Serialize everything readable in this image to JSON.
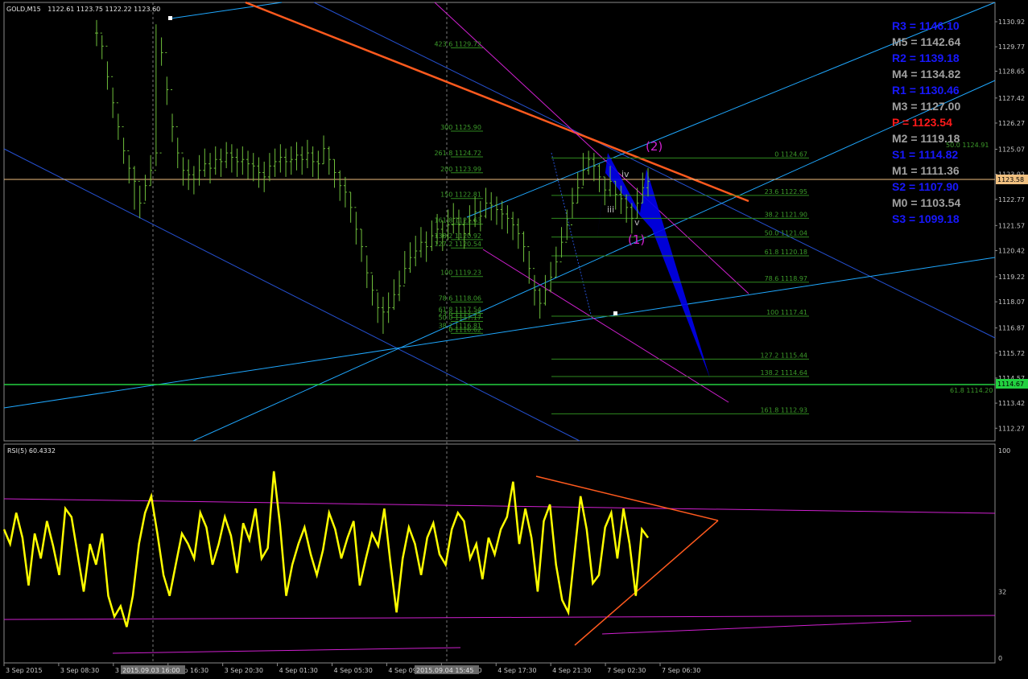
{
  "header": {
    "symbol": "GOLD,M15",
    "ohlc": "1122.61 1123.75 1122.22 1123.60",
    "rsi_title": "RSI(5) 60.4332"
  },
  "colors": {
    "background": "#000000",
    "grid": "#5a5a5a",
    "candle": "#6fbf3c",
    "rsi_line": "#ffff00",
    "trend_orange": "#ff5a1e",
    "channel_light": "#1fa8ff",
    "channel_dark": "#2550d0",
    "magenta": "#d020d0",
    "fib": "#2f8a1f",
    "price_line": "#f0c080",
    "pattern": "#0000f0"
  },
  "chart_data": [
    {
      "type": "line",
      "name": "price",
      "ylim": [
        1111.8,
        1131.4
      ],
      "yticks": [
        "1130.92",
        "1129.77",
        "1128.65",
        "1127.42",
        "1126.27",
        "1125.07",
        "1123.92",
        "1122.77",
        "1121.57",
        "1120.42",
        "1119.22",
        "1118.07",
        "1116.87",
        "1115.72",
        "1114.57",
        "1113.42",
        "1112.27"
      ],
      "xticks": [
        "3 Sep 2015",
        "3 Sep 08:30",
        "3 Sep 12:30",
        "3 Sep 16:30",
        "3 Sep 20:30",
        "4 Sep 01:30",
        "4 Sep 05:30",
        "4 Sep 09:30",
        "4 Sep 13:30",
        "4 Sep 17:30",
        "4 Sep 21:30",
        "7 Sep 02:30",
        "7 Sep 06:30"
      ],
      "xtick_overlays": [
        "2015.09.03 16:00",
        "2015.09.04 15:45"
      ],
      "x_count": 200,
      "close": [
        1130.4,
        1129.8,
        1128.4,
        1127.2,
        1126.1,
        1125.0,
        1124.2,
        1123.6,
        1122.6,
        1123.4,
        1124.1,
        1124.9,
        1129.5,
        1127.8,
        1126.1,
        1124.9,
        1124.1,
        1123.9,
        1123.7,
        1124.1,
        1124.4,
        1124.2,
        1124.6,
        1124.5,
        1124.9,
        1124.7,
        1124.5,
        1124.6,
        1124.4,
        1124.3,
        1124.0,
        1123.8,
        1124.3,
        1124.5,
        1124.7,
        1124.5,
        1124.6,
        1124.8,
        1124.6,
        1124.9,
        1124.5,
        1124.4,
        1125.1,
        1124.6,
        1124.0,
        1123.4,
        1123.1,
        1122.4,
        1121.4,
        1120.6,
        1119.4,
        1118.6,
        1117.8,
        1117.6,
        1117.8,
        1118.4,
        1118.8,
        1119.6,
        1120.1,
        1120.4,
        1120.8,
        1120.6,
        1121.1,
        1121.4,
        1121.1,
        1121.6,
        1121.9,
        1121.6,
        1121.2,
        1121.8,
        1122.2,
        1122.0,
        1122.6,
        1122.5,
        1122.3,
        1122.1,
        1121.9,
        1121.6,
        1121.2,
        1120.6,
        1119.6,
        1118.6,
        1118.0,
        1118.6,
        1119.2,
        1119.9,
        1120.8,
        1121.6,
        1122.6,
        1123.3,
        1124.1,
        1124.6,
        1124.3,
        1123.8,
        1123.2,
        1123.6,
        1123.0,
        1122.8,
        1122.4,
        1121.9,
        1122.6,
        1123.3,
        1123.6
      ],
      "high": [
        1131.0,
        1130.3,
        1129.1,
        1127.9,
        1126.7,
        1125.6,
        1124.8,
        1124.3,
        1123.4,
        1123.9,
        1124.8,
        1130.8,
        1130.2,
        1128.4,
        1126.7,
        1125.6,
        1124.7,
        1124.6,
        1124.3,
        1124.8,
        1125.1,
        1124.9,
        1125.2,
        1125.1,
        1125.4,
        1125.3,
        1125.1,
        1125.2,
        1125.0,
        1124.9,
        1124.7,
        1124.5,
        1124.9,
        1125.1,
        1125.3,
        1125.1,
        1125.2,
        1125.4,
        1125.2,
        1125.5,
        1125.2,
        1125.0,
        1125.7,
        1125.2,
        1124.6,
        1124.1,
        1123.8,
        1123.1,
        1122.2,
        1121.4,
        1120.2,
        1119.3,
        1118.5,
        1118.3,
        1118.5,
        1119.1,
        1119.5,
        1120.4,
        1120.8,
        1121.1,
        1121.5,
        1121.3,
        1121.8,
        1122.1,
        1121.8,
        1122.3,
        1122.6,
        1122.3,
        1121.9,
        1122.5,
        1122.9,
        1122.7,
        1123.3,
        1123.1,
        1122.9,
        1122.7,
        1122.5,
        1122.2,
        1121.9,
        1121.3,
        1120.4,
        1119.3,
        1118.7,
        1119.3,
        1119.9,
        1120.6,
        1121.5,
        1122.3,
        1123.3,
        1124.0,
        1124.9,
        1125.0,
        1124.9,
        1124.4,
        1123.8,
        1124.3,
        1123.6,
        1123.4,
        1123.0,
        1122.6,
        1123.3,
        1124.0,
        1124.2
      ],
      "low": [
        1129.8,
        1129.2,
        1127.8,
        1126.5,
        1125.5,
        1124.4,
        1123.5,
        1122.3,
        1121.9,
        1122.7,
        1123.4,
        1124.3,
        1128.9,
        1127.1,
        1125.4,
        1124.2,
        1123.4,
        1123.2,
        1123.0,
        1123.4,
        1123.8,
        1123.5,
        1123.9,
        1123.8,
        1124.2,
        1124.0,
        1123.8,
        1123.9,
        1123.7,
        1123.6,
        1123.3,
        1123.1,
        1123.6,
        1123.8,
        1124.0,
        1123.8,
        1123.9,
        1124.1,
        1123.9,
        1124.2,
        1123.8,
        1123.7,
        1124.4,
        1123.9,
        1123.3,
        1122.7,
        1122.4,
        1121.7,
        1120.7,
        1119.9,
        1118.7,
        1117.9,
        1117.1,
        1116.6,
        1117.1,
        1117.7,
        1118.1,
        1118.9,
        1119.4,
        1119.7,
        1120.1,
        1119.9,
        1120.4,
        1120.7,
        1120.4,
        1120.9,
        1121.2,
        1120.9,
        1120.5,
        1121.1,
        1121.5,
        1121.3,
        1121.9,
        1121.8,
        1121.6,
        1121.4,
        1121.2,
        1120.9,
        1120.5,
        1119.9,
        1118.9,
        1117.9,
        1117.3,
        1117.9,
        1118.5,
        1119.2,
        1120.1,
        1120.9,
        1121.9,
        1122.6,
        1123.4,
        1123.9,
        1123.6,
        1123.1,
        1122.5,
        1122.9,
        1122.3,
        1122.1,
        1121.7,
        1121.2,
        1121.9,
        1122.6,
        1122.9
      ]
    },
    {
      "type": "line",
      "name": "RSI(5) 60.4332",
      "ylim": [
        0,
        100
      ],
      "yticks": [
        "100",
        "32",
        "0"
      ],
      "values": [
        62,
        55,
        70,
        58,
        35,
        60,
        48,
        66,
        54,
        40,
        72,
        68,
        50,
        32,
        55,
        45,
        60,
        30,
        20,
        25,
        15,
        30,
        55,
        70,
        78,
        60,
        40,
        30,
        45,
        60,
        55,
        48,
        70,
        63,
        45,
        55,
        68,
        59,
        41,
        65,
        57,
        72,
        48,
        53,
        90,
        64,
        30,
        45,
        55,
        63,
        50,
        40,
        52,
        70,
        62,
        48,
        58,
        66,
        35,
        48,
        60,
        54,
        72,
        46,
        22,
        48,
        63,
        55,
        40,
        58,
        65,
        50,
        45,
        62,
        70,
        66,
        48,
        55,
        38,
        58,
        50,
        62,
        68,
        85,
        55,
        72,
        58,
        32,
        66,
        74,
        45,
        28,
        22,
        50,
        78,
        62,
        36,
        40,
        63,
        70,
        48,
        72,
        55,
        30,
        62,
        58
      ]
    }
  ],
  "fib_levels": [
    {
      "label": "423.6 1129.72"
    },
    {
      "label": "300 1125.90"
    },
    {
      "label": "261.8 1124.72"
    },
    {
      "label": "200 1123.99"
    },
    {
      "label": "150 1122.81"
    },
    {
      "label": "161.8 1121.63"
    },
    {
      "label": "138.2 1120.92"
    },
    {
      "label": "127.2 1120.54"
    },
    {
      "label": "100 1119.23"
    },
    {
      "label": "78.6 1118.06"
    },
    {
      "label": "61.8 1117.54"
    },
    {
      "label": "50.0 1117.17"
    },
    {
      "label": "38.2 1116.81"
    },
    {
      "label": "23.6 1117.35"
    },
    {
      "label": "0 1116.62"
    }
  ],
  "fib_levels_right": [
    {
      "label": "0 1124.67"
    },
    {
      "label": "23.6 1122.95"
    },
    {
      "label": "38.2 1121.90"
    },
    {
      "label": "50.0 1121.04"
    },
    {
      "label": "61.8 1120.18"
    },
    {
      "label": "78.6 1118.97"
    },
    {
      "label": "100 1117.41"
    },
    {
      "label": "127.2 1115.44"
    },
    {
      "label": "138.2 1114.64"
    },
    {
      "label": "161.8 1112.93"
    }
  ],
  "extra_labels": {
    "fib_far_1": "50.0 1124.91",
    "fib_far_2": "61.8 1114.20",
    "price_marker": "1123.58",
    "green_marker": "1114.67"
  },
  "pivots": [
    {
      "label": "R3 = 1146.10",
      "color": "#1818ff"
    },
    {
      "label": "M5 = 1142.64",
      "color": "#a0a0a0"
    },
    {
      "label": "R2 = 1139.18",
      "color": "#1818ff"
    },
    {
      "label": "M4 = 1134.82",
      "color": "#a0a0a0"
    },
    {
      "label": "R1 = 1130.46",
      "color": "#1818ff"
    },
    {
      "label": "M3 = 1127.00",
      "color": "#a0a0a0"
    },
    {
      "label": "P   = 1123.54",
      "color": "#ff1a1a"
    },
    {
      "label": "M2 = 1119.18",
      "color": "#a0a0a0"
    },
    {
      "label": "S1 = 1114.82",
      "color": "#1818ff"
    },
    {
      "label": "M1 = 1111.36",
      "color": "#a0a0a0"
    },
    {
      "label": "S2 = 1107.90",
      "color": "#1818ff"
    },
    {
      "label": "M0 = 1103.54",
      "color": "#a0a0a0"
    },
    {
      "label": "S3 = 1099.18",
      "color": "#1818ff"
    }
  ],
  "waves": {
    "w2": "(2)",
    "w1": "(1)",
    "iii": "iii",
    "iv": "iv",
    "v": "v"
  }
}
